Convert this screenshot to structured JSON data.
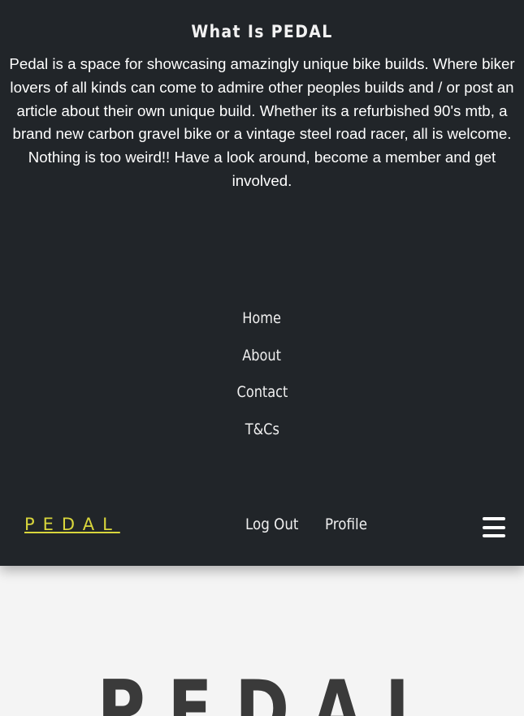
{
  "about": {
    "title": "What Is PEDAL",
    "body": "Pedal is a space for showcasing amazingly unique bike builds. Where biker lovers of all kinds can come to admire other peoples builds and / or post an article about their own unique build. Whether its a refurbished 90's mtb, a brand new carbon gravel bike or a vintage steel road racer, all is welcome. Nothing is too weird!! Have a look around, become a member and get involved."
  },
  "menu": {
    "items": [
      {
        "label": "Home"
      },
      {
        "label": "About"
      },
      {
        "label": "Contact"
      },
      {
        "label": "T&Cs"
      }
    ]
  },
  "navbar": {
    "logo": "PEDAL",
    "logout_label": "Log Out",
    "profile_label": "Profile",
    "menu_icon": "hamburger-icon"
  },
  "hero": {
    "logo": "PEDAL"
  },
  "colors": {
    "panel_bg": "#212529",
    "page_bg": "#f4f4f4",
    "logo_accent": "#d9d63c"
  }
}
